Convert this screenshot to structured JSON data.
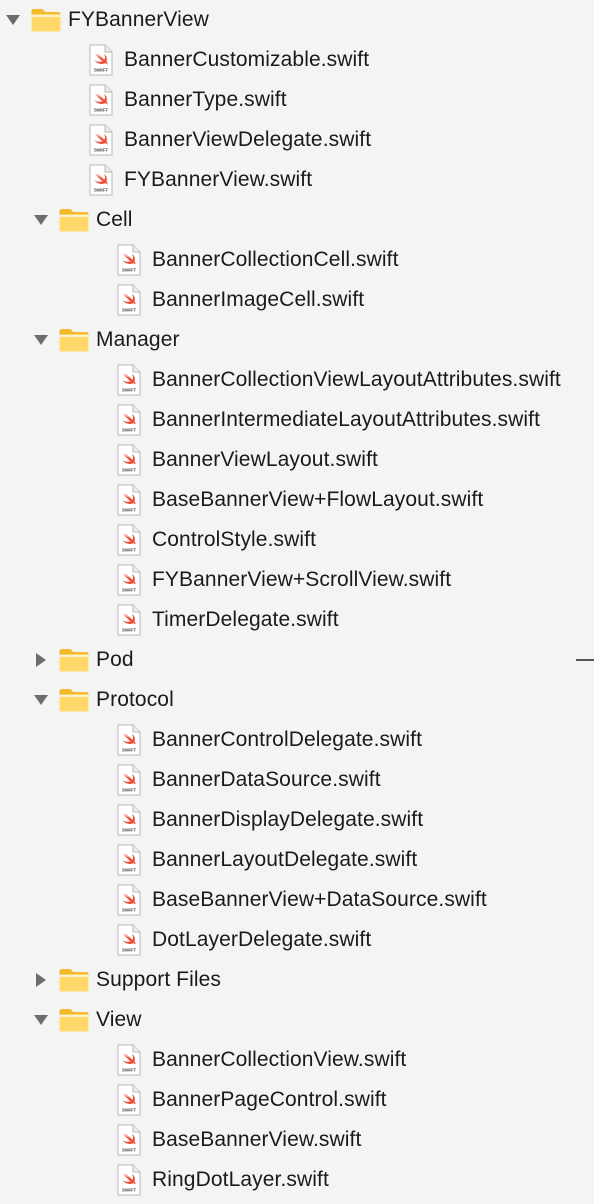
{
  "project_navigator": {
    "items": [
      {
        "type": "folder",
        "level": 0,
        "expanded": true,
        "label": "FYBannerView"
      },
      {
        "type": "file",
        "level": 1,
        "icon": "swift-file-icon",
        "label": "BannerCustomizable.swift"
      },
      {
        "type": "file",
        "level": 1,
        "icon": "swift-file-icon",
        "label": "BannerType.swift"
      },
      {
        "type": "file",
        "level": 1,
        "icon": "swift-file-icon",
        "label": "BannerViewDelegate.swift"
      },
      {
        "type": "file",
        "level": 1,
        "icon": "swift-file-icon",
        "label": "FYBannerView.swift"
      },
      {
        "type": "folder",
        "level": 1,
        "expanded": true,
        "label": "Cell"
      },
      {
        "type": "file",
        "level": 2,
        "icon": "swift-file-icon",
        "label": "BannerCollectionCell.swift"
      },
      {
        "type": "file",
        "level": 2,
        "icon": "swift-file-icon",
        "label": "BannerImageCell.swift"
      },
      {
        "type": "folder",
        "level": 1,
        "expanded": true,
        "label": "Manager"
      },
      {
        "type": "file",
        "level": 2,
        "icon": "swift-file-icon",
        "label": "BannerCollectionViewLayoutAttributes.swift"
      },
      {
        "type": "file",
        "level": 2,
        "icon": "swift-file-icon",
        "label": "BannerIntermediateLayoutAttributes.swift"
      },
      {
        "type": "file",
        "level": 2,
        "icon": "swift-file-icon",
        "label": "BannerViewLayout.swift"
      },
      {
        "type": "file",
        "level": 2,
        "icon": "swift-file-icon",
        "label": "BaseBannerView+FlowLayout.swift"
      },
      {
        "type": "file",
        "level": 2,
        "icon": "swift-file-icon",
        "label": "ControlStyle.swift"
      },
      {
        "type": "file",
        "level": 2,
        "icon": "swift-file-icon",
        "label": "FYBannerView+ScrollView.swift"
      },
      {
        "type": "file",
        "level": 2,
        "icon": "swift-file-icon",
        "label": "TimerDelegate.swift"
      },
      {
        "type": "folder",
        "level": 1,
        "expanded": false,
        "label": "Pod"
      },
      {
        "type": "folder",
        "level": 1,
        "expanded": true,
        "label": "Protocol"
      },
      {
        "type": "file",
        "level": 2,
        "icon": "swift-file-icon",
        "label": "BannerControlDelegate.swift"
      },
      {
        "type": "file",
        "level": 2,
        "icon": "swift-file-icon",
        "label": "BannerDataSource.swift"
      },
      {
        "type": "file",
        "level": 2,
        "icon": "swift-file-icon",
        "label": "BannerDisplayDelegate.swift"
      },
      {
        "type": "file",
        "level": 2,
        "icon": "swift-file-icon",
        "label": "BannerLayoutDelegate.swift"
      },
      {
        "type": "file",
        "level": 2,
        "icon": "swift-file-icon",
        "label": "BaseBannerView+DataSource.swift"
      },
      {
        "type": "file",
        "level": 2,
        "icon": "swift-file-icon",
        "label": "DotLayerDelegate.swift"
      },
      {
        "type": "folder",
        "level": 1,
        "expanded": false,
        "label": "Support Files"
      },
      {
        "type": "folder",
        "level": 1,
        "expanded": true,
        "label": "View"
      },
      {
        "type": "file",
        "level": 2,
        "icon": "swift-file-icon",
        "label": "BannerCollectionView.swift"
      },
      {
        "type": "file",
        "level": 2,
        "icon": "swift-file-icon",
        "label": "BannerPageControl.swift"
      },
      {
        "type": "file",
        "level": 2,
        "icon": "swift-file-icon",
        "label": "BaseBannerView.swift"
      },
      {
        "type": "file",
        "level": 2,
        "icon": "swift-file-icon",
        "label": "RingDotLayer.swift"
      }
    ]
  },
  "colors": {
    "background": "#f4f4f4",
    "folder_light": "#ffd76a",
    "folder_dark": "#f5b92c",
    "swift_orange": "#f05138",
    "text": "#1a1a1a",
    "disclosure": "#6d6d6d"
  }
}
